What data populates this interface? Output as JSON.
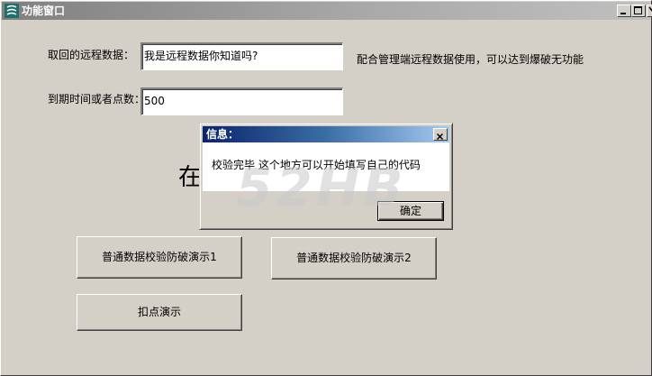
{
  "window": {
    "title": "功能窗口",
    "controls": [
      "minimize",
      "maximize",
      "close"
    ]
  },
  "form": {
    "remote_data_label": "取回的远程数据：",
    "remote_data_value": "我是远程数据你知道吗?",
    "remote_data_note": "配合管理端远程数据使用，可以达到爆破无功能",
    "expiry_label": "到期时间或者点数：",
    "expiry_value": "500",
    "big_text": "在"
  },
  "buttons": {
    "demo1": "普通数据校验防破演示1",
    "demo2": "普通数据校验防破演示2",
    "deduct": "扣点演示"
  },
  "dialog": {
    "title": "信息：",
    "message": "校验完毕 这个地方可以开始填写自己的代码",
    "ok": "确定"
  },
  "watermark": "52HB",
  "colors": {
    "window_bg": "#d4d0c8",
    "inactive_title": "#808080",
    "active_title_start": "#0a246a",
    "active_title_end": "#a6caf0"
  }
}
